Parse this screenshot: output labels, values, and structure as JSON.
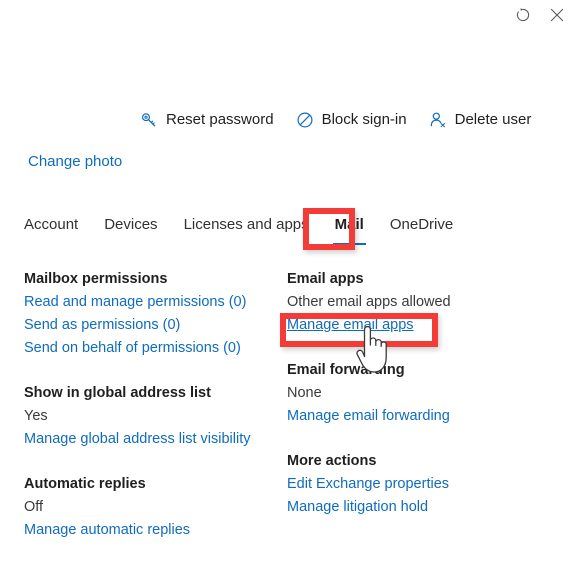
{
  "window": {
    "refresh_icon": "refresh-icon",
    "close_icon": "close-icon"
  },
  "command_bar": {
    "items": [
      {
        "label": "Reset password",
        "icon": "key-icon"
      },
      {
        "label": "Block sign-in",
        "icon": "block-circle-slash-icon"
      },
      {
        "label": "Delete user",
        "icon": "person-delete-icon"
      }
    ]
  },
  "profile": {
    "change_photo_label": "Change photo"
  },
  "tabs": [
    {
      "label": "Account",
      "selected": false
    },
    {
      "label": "Devices",
      "selected": false
    },
    {
      "label": "Licenses and apps",
      "selected": false
    },
    {
      "label": "Mail",
      "selected": true
    },
    {
      "label": "OneDrive",
      "selected": false
    }
  ],
  "left_column": {
    "mailbox_permissions": {
      "title": "Mailbox permissions",
      "links": [
        "Read and manage permissions (0)",
        "Send as permissions (0)",
        "Send on behalf of permissions (0)"
      ]
    },
    "global_address_list": {
      "title": "Show in global address list",
      "value": "Yes",
      "link": "Manage global address list visibility"
    },
    "automatic_replies": {
      "title": "Automatic replies",
      "value": "Off",
      "link": "Manage automatic replies"
    }
  },
  "right_column": {
    "email_apps": {
      "title": "Email apps",
      "value": "Other email apps allowed",
      "link": "Manage email apps"
    },
    "email_forwarding": {
      "title": "Email forwarding",
      "value": "None",
      "link": "Manage email forwarding"
    },
    "more_actions": {
      "title": "More actions",
      "links": [
        "Edit Exchange properties",
        "Manage litigation hold"
      ]
    }
  },
  "annotations": {
    "color": "#f33c38",
    "boxes": [
      {
        "target": "tab-mail"
      },
      {
        "target": "manage-email-apps-link"
      }
    ],
    "cursor": "pointing-hand-cursor"
  },
  "colors": {
    "link": "#0f6cbd",
    "text": "#323130",
    "annotation_red": "#f33c38"
  }
}
